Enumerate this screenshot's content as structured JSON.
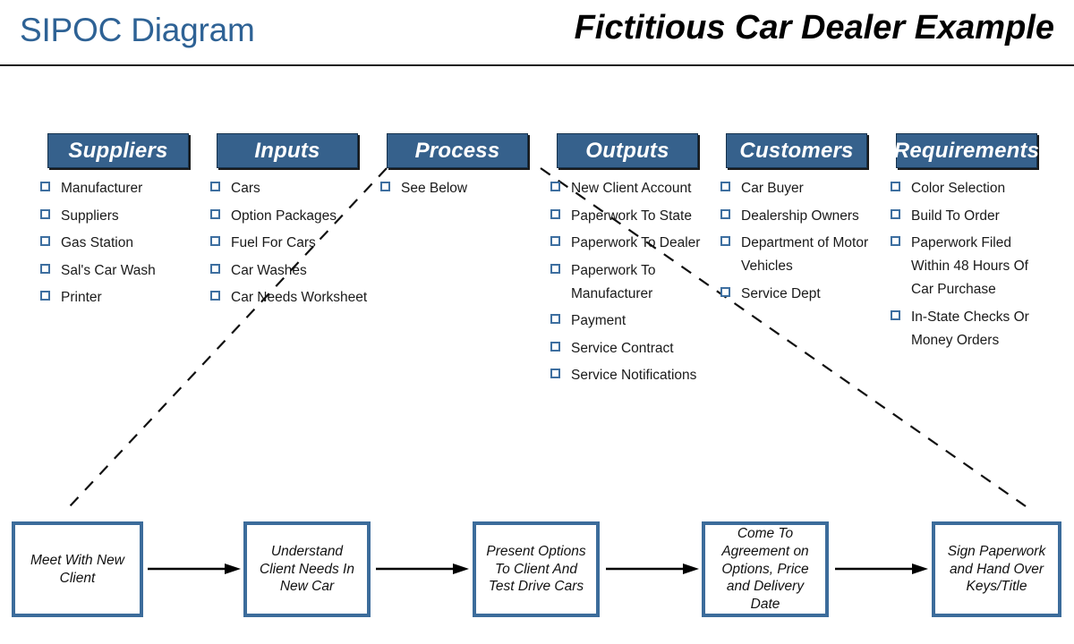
{
  "header": {
    "title_left": "SIPOC Diagram",
    "title_right": "Fictitious Car Dealer Example",
    "accent_color": "#2E6295",
    "header_box_color": "#36618C",
    "bullet_color": "#3E6FA0",
    "process_box_border_color": "#3C6C9B"
  },
  "columns": [
    {
      "key": "suppliers",
      "label": "Suppliers",
      "items": [
        "Manufacturer",
        "Suppliers",
        "Gas Station",
        "Sal's Car Wash",
        "Printer"
      ]
    },
    {
      "key": "inputs",
      "label": "Inputs",
      "items": [
        "Cars",
        "Option Packages",
        "Fuel For Cars",
        "Car Washes",
        "Car Needs Worksheet"
      ]
    },
    {
      "key": "process",
      "label": "Process",
      "items": [
        "See Below"
      ]
    },
    {
      "key": "outputs",
      "label": "Outputs",
      "items": [
        "New Client Account",
        "Paperwork To State",
        "Paperwork To Dealer",
        "Paperwork To Manufacturer",
        "Payment",
        "Service Contract",
        "Service Notifications"
      ]
    },
    {
      "key": "customers",
      "label": "Customers",
      "items": [
        "Car Buyer",
        "Dealership Owners",
        "Department of Motor Vehicles",
        "Service Dept"
      ]
    },
    {
      "key": "requirements",
      "label": "Requirements",
      "items": [
        "Color Selection",
        "Build To Order",
        "Paperwork Filed Within 48 Hours Of Car Purchase",
        "In-State Checks Or Money Orders"
      ]
    }
  ],
  "process_flow": {
    "steps": [
      "Meet With New Client",
      "Understand Client Needs In New Car",
      "Present Options To Client And Test Drive Cars",
      "Come To Agreement on Options, Price and Delivery Date",
      "Sign Paperwork and Hand Over Keys/Title"
    ],
    "connector_icon": "arrow-right-icon"
  }
}
